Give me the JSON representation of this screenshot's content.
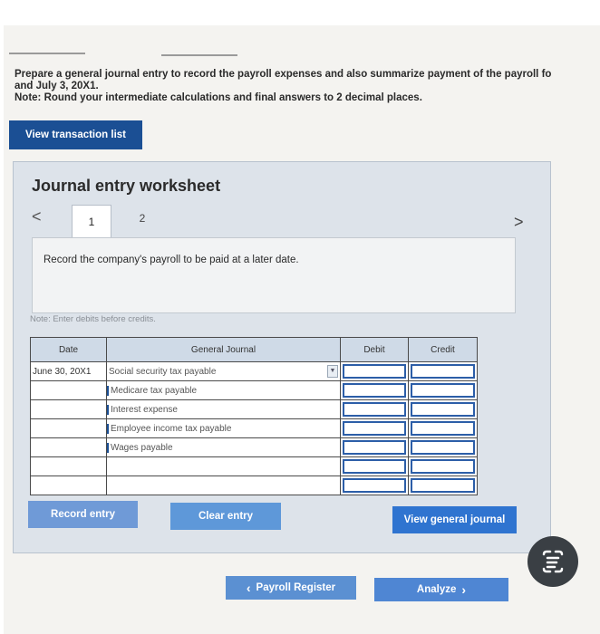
{
  "instructions": {
    "line1": "Prepare a general journal entry to record the payroll expenses and also summarize payment of the payroll fo",
    "line2": "and July 3, 20X1.",
    "line3": "Note: Round your intermediate calculations and final answers to 2 decimal places."
  },
  "buttons": {
    "view_transaction_list": "View transaction list",
    "record_entry": "Record entry",
    "clear_entry": "Clear entry",
    "view_general_journal": "View general journal",
    "prev_label": "Payroll Register",
    "next_label": "Analyze"
  },
  "worksheet": {
    "title": "Journal entry worksheet",
    "tabs": [
      "1",
      "2"
    ],
    "description": "Record the company's payroll to be paid at a later date.",
    "note": "Note: Enter debits before credits."
  },
  "table": {
    "headers": {
      "date": "Date",
      "general_journal": "General Journal",
      "debit": "Debit",
      "credit": "Credit"
    },
    "rows": [
      {
        "date": "June 30, 20X1",
        "account": "Social security tax payable"
      },
      {
        "date": "",
        "account": "Medicare tax payable"
      },
      {
        "date": "",
        "account": "Interest expense"
      },
      {
        "date": "",
        "account": "Employee income tax payable"
      },
      {
        "date": "",
        "account": "Wages payable"
      },
      {
        "date": "",
        "account": ""
      },
      {
        "date": "",
        "account": ""
      }
    ]
  },
  "icons": {
    "prev": "‹",
    "next": "›",
    "left": "<",
    "right": ">"
  },
  "colors": {
    "primary_button": "#1b4f94",
    "action_button": "#5e98d9",
    "header_bg": "#cfdae7"
  }
}
